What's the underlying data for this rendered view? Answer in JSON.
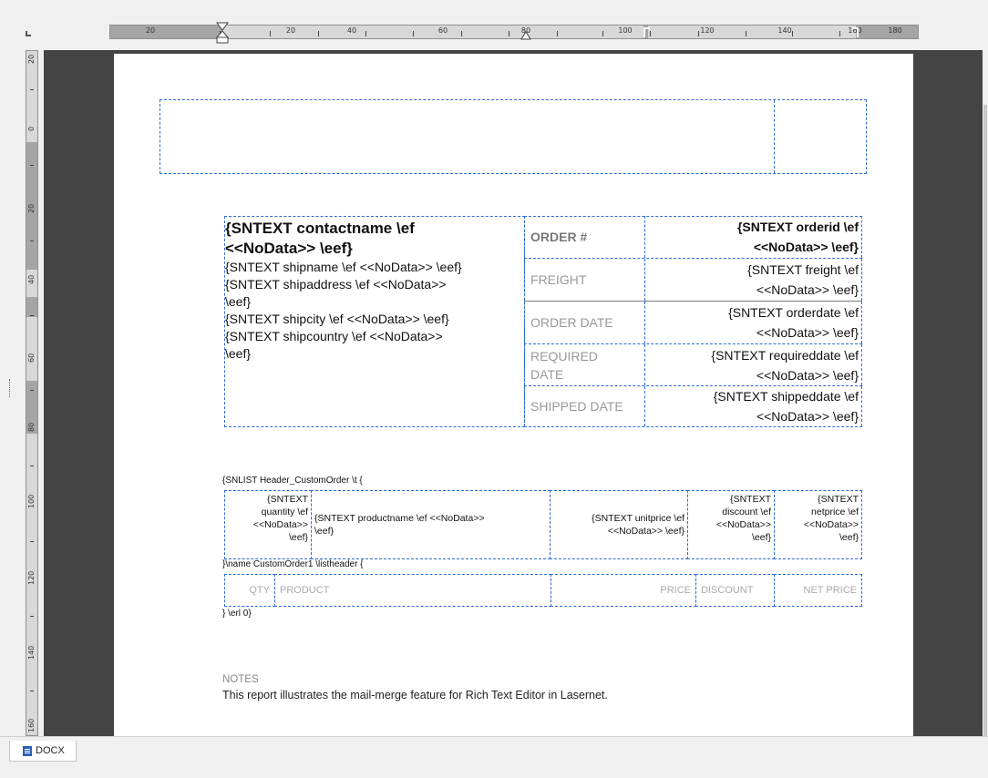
{
  "ruler": {
    "h_labels": [
      "20",
      "20",
      "40",
      "60",
      "80",
      "100",
      "120",
      "140",
      "160",
      "180"
    ],
    "v_labels": [
      "20",
      "0",
      "20",
      "40",
      "60",
      "80",
      "100",
      "120",
      "140",
      "160"
    ]
  },
  "address": {
    "contactname_l1": "{SNTEXT contactname \\ef",
    "contactname_l2": "<<NoData>> \\eef}",
    "l1": "{SNTEXT shipname \\ef <<NoData>> \\eef}",
    "l2": "{SNTEXT shipaddress \\ef <<NoData>>",
    "l3": "\\eef}",
    "l4": "{SNTEXT shipcity \\ef <<NoData>> \\eef}",
    "l5": "{SNTEXT shipcountry \\ef <<NoData>>",
    "l6": "\\eef}"
  },
  "order": {
    "order_label": "ORDER #",
    "order_v1": "{SNTEXT orderid \\ef",
    "order_v2": "<<NoData>> \\eef}",
    "freight_label": "FREIGHT",
    "freight_v1": "{SNTEXT freight \\ef",
    "freight_v2": "<<NoData>> \\eef}",
    "orderdate_label": "ORDER DATE",
    "orderdate_v1": "{SNTEXT orderdate \\ef",
    "orderdate_v2": "<<NoData>> \\eef}",
    "required_label_1": "REQUIRED",
    "required_label_2": "DATE",
    "required_v1": "{SNTEXT requireddate \\ef",
    "required_v2": "<<NoData>> \\eef}",
    "shipped_label": "SHIPPED DATE",
    "shipped_v1": "{SNTEXT shippeddate \\ef",
    "shipped_v2": "<<NoData>> \\eef}"
  },
  "list": {
    "header_field": "{SNLIST Header_CustomOrder \\t {",
    "qty": [
      "{SNTEXT",
      "quantity \\ef",
      "<<NoData>>",
      "\\eef}"
    ],
    "product": [
      "{SNTEXT productname \\ef <<NoData>>",
      "\\eef}"
    ],
    "unitprice": [
      "{SNTEXT unitprice \\ef",
      "<<NoData>> \\eef}"
    ],
    "discount": [
      "{SNTEXT",
      "discount \\ef",
      "<<NoData>>",
      "\\eef}"
    ],
    "netprice": [
      "{SNTEXT",
      "netprice \\ef",
      "<<NoData>>",
      "\\eef}"
    ],
    "name_field": "}\\name CustomOrder1 \\listheader {",
    "end_field": "} \\erl 0}",
    "col_qty": "QTY",
    "col_product": "PRODUCT",
    "col_price": "PRICE",
    "col_discount": "DISCOUNT",
    "col_netprice": "NET PRICE"
  },
  "notes": {
    "label": "NOTES",
    "text": "This report illustrates the mail-merge feature for Rich Text Editor in Lasernet."
  },
  "tabs": {
    "docx": "DOCX"
  },
  "colors": {
    "field_border": "#2b6cd4",
    "canvas": "#444444",
    "docx_icon": "#2b5fb9"
  }
}
